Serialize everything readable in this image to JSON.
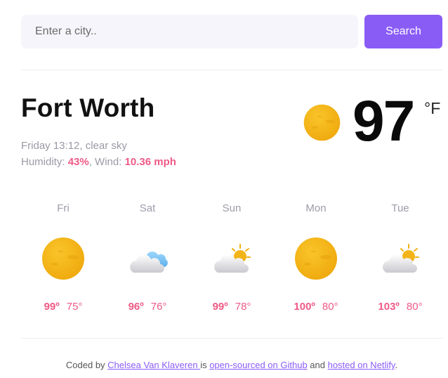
{
  "search": {
    "placeholder": "Enter a city..",
    "button_label": "Search"
  },
  "current": {
    "city": "Fort Worth",
    "datetime_description": "Friday 13:12, clear sky",
    "humidity_label": "Humidity: ",
    "humidity_value": "43%",
    "wind_label": ", Wind: ",
    "wind_value": "10.36 mph",
    "temperature": "97",
    "unit": "°F",
    "icon": "sun-icon"
  },
  "forecast": [
    {
      "day": "Fri",
      "max": "99º",
      "min": "75°",
      "icon": "sun-icon"
    },
    {
      "day": "Sat",
      "max": "96º",
      "min": "76°",
      "icon": "cloud-icon"
    },
    {
      "day": "Sun",
      "max": "99º",
      "min": "78°",
      "icon": "partly-cloudy-icon"
    },
    {
      "day": "Mon",
      "max": "100º",
      "min": "80°",
      "icon": "sun-icon"
    },
    {
      "day": "Tue",
      "max": "103º",
      "min": "80°",
      "icon": "partly-cloudy-icon"
    }
  ],
  "footer": {
    "prefix": "Coded by ",
    "author_link": "Chelsea Van Klaveren ",
    "middle": "is ",
    "github_link": "open-sourced on Github",
    "and_text": " and ",
    "netlify_link": "hosted on Netlify",
    "suffix": "."
  },
  "colors": {
    "accent": "#8a5cf6",
    "highlight": "#ee5a86",
    "sun": "#f2b418"
  }
}
